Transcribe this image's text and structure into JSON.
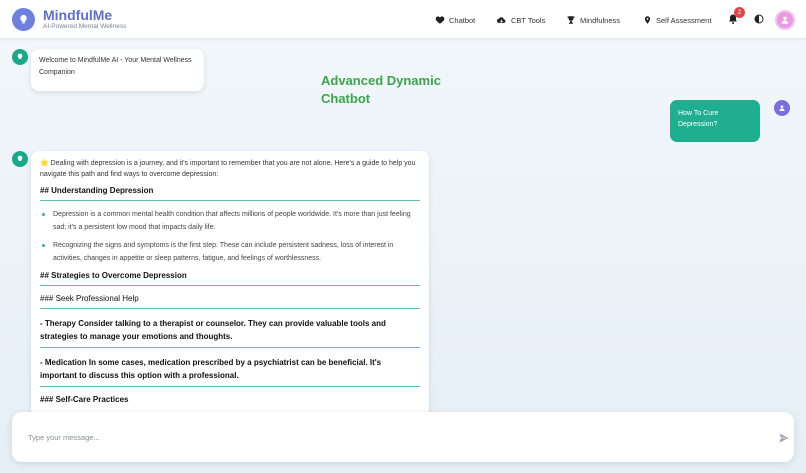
{
  "brand": {
    "title": "MindfulMe",
    "subtitle": "AI-Powered Mental Wellness",
    "logo_icon": "brain-bulb-icon",
    "accent": "#5b6ed6"
  },
  "nav": {
    "items": [
      {
        "label": "Chatbot",
        "icon": "heart-icon"
      },
      {
        "label": "CBT Tools",
        "icon": "cloud-icon"
      },
      {
        "label": "Mindfulness",
        "icon": "trophy-icon"
      },
      {
        "label": "Self Assessment",
        "icon": "location-pin-icon"
      }
    ],
    "notification_count": "2"
  },
  "chat": {
    "welcome": "Welcome to MindfulMe AI - Your Mental Wellness Companion",
    "hero_title": "Advanced Dynamic Chatbot",
    "user_message": "How To Cure Depression?",
    "bot_response": {
      "intro": "🌟 Dealing with depression is a journey, and it's important to remember that you are not alone. Here's a guide to help you navigate this path and find ways to overcome depression:",
      "heading1": "## Understanding Depression",
      "bullets": [
        "Depression is a common mental health condition that affects millions of people worldwide. It's more than just feeling sad; it's a persistent low mood that impacts daily life.",
        "Recognizing the signs and symptoms is the first step. These can include persistent sadness, loss of interest in activities, changes in appetite or sleep patterns, fatigue, and feelings of worthlessness."
      ],
      "heading2": "## Strategies to Overcome Depression",
      "subheading1": "### Seek Professional Help",
      "para1": "- Therapy Consider talking to a therapist or counselor. They can provide valuable tools and strategies to manage your emotions and thoughts.",
      "para2": "- Medication In some cases, medication prescribed by a psychiatrist can be beneficial. It's important to discuss this option with a professional.",
      "subheading2": "### Self-Care Practices"
    }
  },
  "input": {
    "placeholder": "Type your message...",
    "value": ""
  },
  "colors": {
    "bot_avatar": "#18a98a",
    "user_bubble": "#1fae8f",
    "user_avatar": "#7b6ee0",
    "hero_title": "#3aa64a",
    "badge": "#e04848"
  }
}
